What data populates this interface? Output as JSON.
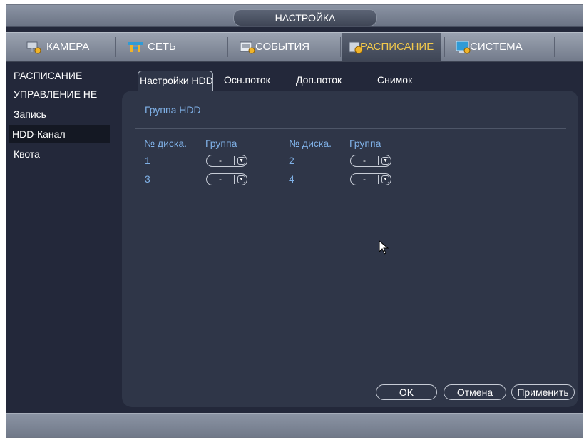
{
  "title": "НАСТРОЙКА",
  "menu": [
    {
      "label": "КАМЕРА",
      "icon": "camera-settings-icon"
    },
    {
      "label": "СЕТЬ",
      "icon": "network-icon"
    },
    {
      "label": "СОБЫТИЯ",
      "icon": "events-icon"
    },
    {
      "label": "РАСПИСАНИЕ",
      "icon": "schedule-icon",
      "active": true
    },
    {
      "label": "СИСТЕМА",
      "icon": "system-icon"
    }
  ],
  "sidebar": [
    {
      "label": "РАСПИСАНИЕ"
    },
    {
      "label": "УПРАВЛЕНИЕ НЕ"
    },
    {
      "label": "Запись"
    },
    {
      "label": "HDD-Канал",
      "active": true
    },
    {
      "label": "Квота"
    }
  ],
  "subtabs": [
    {
      "label": "Настройки HDD",
      "active": true
    },
    {
      "label": "Осн.поток"
    },
    {
      "label": "Доп.поток"
    },
    {
      "label": "Снимок"
    }
  ],
  "section_title": "Группа HDD",
  "columns": {
    "disk": "№ диска.",
    "group": "Группа"
  },
  "disks": [
    {
      "num": "1",
      "group": "-"
    },
    {
      "num": "2",
      "group": "-"
    },
    {
      "num": "3",
      "group": "-"
    },
    {
      "num": "4",
      "group": "-"
    }
  ],
  "buttons": {
    "ok": "OK",
    "cancel": "Отмена",
    "apply": "Применить"
  },
  "colors": {
    "accent": "#f2c94c",
    "label": "#7fb0e6",
    "panel": "#2f3648"
  }
}
